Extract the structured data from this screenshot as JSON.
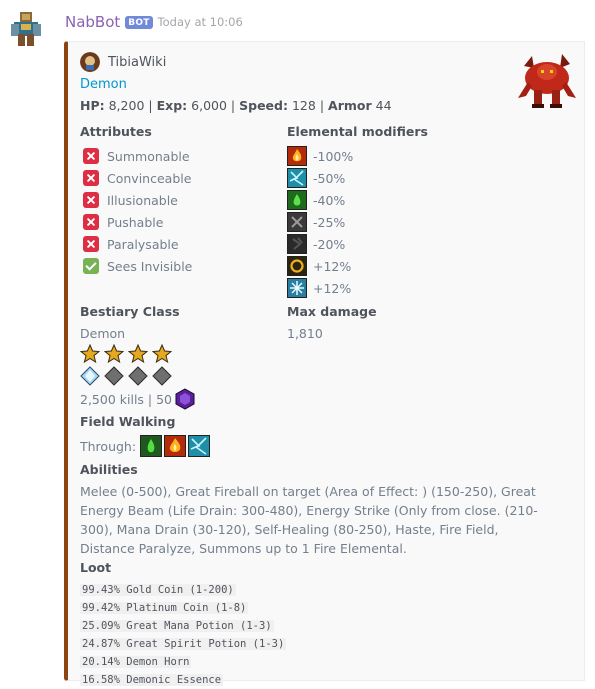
{
  "message": {
    "author": "NabBot",
    "bot_tag": "BOT",
    "timestamp": "Today at 10:06",
    "avatar_icon": "nabbot-avatar-icon"
  },
  "embed": {
    "accent_color": "#8b4513",
    "author_name": "TibiaWiki",
    "author_icon": "tibiawiki-logo-icon",
    "title": "Demon",
    "thumbnail": "demon-creature-sprite",
    "stats": {
      "hp_label": "HP:",
      "hp": "8,200",
      "exp_label": "Exp:",
      "exp": "6,000",
      "speed_label": "Speed:",
      "speed": "128",
      "armor_label": "Armor",
      "armor": "44",
      "sep": "|"
    },
    "attributes": {
      "title": "Attributes",
      "items": [
        {
          "label": "Summonable",
          "icon": "cross-mark-icon"
        },
        {
          "label": "Convinceable",
          "icon": "cross-mark-icon"
        },
        {
          "label": "Illusionable",
          "icon": "cross-mark-icon"
        },
        {
          "label": "Pushable",
          "icon": "cross-mark-icon"
        },
        {
          "label": "Paralysable",
          "icon": "cross-mark-icon"
        },
        {
          "label": "Sees Invisible",
          "icon": "check-mark-icon"
        }
      ]
    },
    "elemental": {
      "title": "Elemental modifiers",
      "items": [
        {
          "icon": "fire-element-icon",
          "value": "-100%",
          "color": "#b52a08"
        },
        {
          "icon": "energy-element-icon",
          "value": "-50%",
          "color": "#1f8fa8"
        },
        {
          "icon": "earth-element-icon",
          "value": "-40%",
          "color": "#1e6b1e"
        },
        {
          "icon": "physical-element-icon",
          "value": "-25%",
          "color": "#3a3a3a"
        },
        {
          "icon": "death-element-icon",
          "value": "-20%",
          "color": "#2a2a2a"
        },
        {
          "icon": "holy-element-icon",
          "value": "+12%",
          "color": "#2b2410"
        },
        {
          "icon": "ice-element-icon",
          "value": "+12%",
          "color": "#2a7fa0"
        }
      ]
    },
    "bestiary": {
      "title": "Bestiary Class",
      "class": "Demon",
      "difficulty_stars": 4,
      "occurrence": {
        "filled": 1,
        "total": 4
      },
      "kills_text": "2,500 kills | 50",
      "charm_icon": "charm-points-icon"
    },
    "max_damage": {
      "title": "Max damage",
      "value": "1,810"
    },
    "field_walking": {
      "title": "Field Walking",
      "through_label": "Through:",
      "icons": [
        "poison-field-icon",
        "fire-field-icon",
        "energy-field-icon"
      ]
    },
    "abilities": {
      "title": "Abilities",
      "text": "Melee (0-500), Great Fireball on target (Area of Effect: ) (150-250), Great Energy Beam (Life Drain: 300-480), Energy Strike (Only from close. (210-300), Mana Drain (30-120), Self-Healing (80-250), Haste, Fire Field, Distance Paralyze, Summons up to 1 Fire Elemental."
    },
    "loot": {
      "title": "Loot",
      "items": [
        "99.43% Gold Coin (1-200)",
        "99.42% Platinum Coin (1-8)",
        "25.09% Great Mana Potion (1-3)",
        "24.87% Great Spirit Potion (1-3)",
        "20.14% Demon Horn",
        "16.58% Demonic Essence"
      ]
    }
  }
}
